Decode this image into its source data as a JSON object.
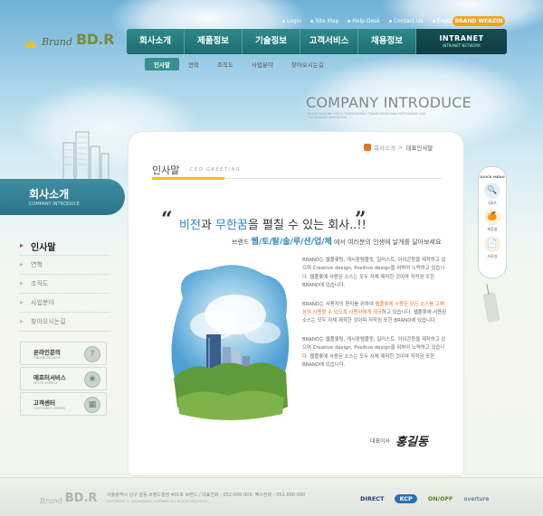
{
  "utility": [
    "Login",
    "Site Map",
    "Help Desk",
    "Contact Us",
    "English"
  ],
  "webzin": "BRAND WEBZIN",
  "logo": {
    "brand": "Brand",
    "mark": "BD.R"
  },
  "gnb": [
    "회사소개",
    "제품정보",
    "기술정보",
    "고객서비스",
    "채용정보"
  ],
  "intranet": {
    "title": "INTRANET",
    "subtitle": "INTRANET NETWORK"
  },
  "submenu": [
    "인사말",
    "연혁",
    "조직도",
    "사업분야",
    "찾아오시는길"
  ],
  "page_title": "COMPANY INTRODUCE",
  "page_subtitle": "BRAND WEBZINE OFFICE PROFESSIONAL TRANSFORMATIONAL PARTNERSHIP AND TECHNOLOGY INNOVATION",
  "section": {
    "title": "회사소개",
    "subtitle": "COMPANY INTRODUCE"
  },
  "left_menu": [
    "인사말",
    "연혁",
    "조직도",
    "사업분야",
    "찾아오시는길"
  ],
  "banners": [
    {
      "title": "온라인문의",
      "subtitle": "ONLINE REQUEST",
      "icon": "?"
    },
    {
      "title": "애프터서비스",
      "subtitle": "AFTER SERVICE",
      "icon": "❀"
    },
    {
      "title": "고객센터",
      "subtitle": "CUSTOMER CENTER",
      "icon": "▦"
    }
  ],
  "breadcrumb": {
    "home": "회사소개",
    "sep": ">",
    "current": "대표인사말"
  },
  "content_title": {
    "ko": "인사말",
    "en": "CEO GREETING"
  },
  "slogan": {
    "open_quote": "“",
    "close_quote": "”",
    "w1": "비전",
    "t1": "과 ",
    "w2": "무한꿈",
    "t2": "을 펼칠 수 있는 회사..!!",
    "l2a": "브랜드 ",
    "l2b": "웹/토/탈/솔/루/션/업/체",
    "l2c": " 에서 여러분의 인생에 날개를 달아보세요"
  },
  "body": {
    "p1": "BRAND는 웹플롯팅, 게시판템플릿, 일러스트, 아이콘등을 제작하고 있으며 Creative design, Positive design을 위하여 노력하고 있습니다. 웹플롯에 사용된 소스는 모두 자체 제작한 것이며 저작권 또한 BRAND에 있습니다.",
    "p2a": "BRAND는 사용자의 편리를 위하여 ",
    "p2b": "웹플롯에 사용된 모든 소스를 고해상의 사용할 수 있도록 사용자에게 제공",
    "p2c": "하고 있습니다. 웹플롯에 사용된 소스는 모두 자체 제작한 것이며 저작권 또한 BRAND에 있습니다.",
    "p3": "BRAND는 웹플롯팅, 게시판템플릿, 일러스트, 아이콘등을 제작하고 있으며 Creative design, Positive design을 위하여 노력하고 있습니다. 웹플롯에 사용된 소스는 모두 자체 제작한 것이며 저작권 또한 BRAND에 있습니다."
  },
  "sign": {
    "label": "대표이사",
    "name": "홍길동"
  },
  "quick": {
    "title": "QUICK MENU",
    "items": [
      {
        "label": "Q&A",
        "icon": "🔍"
      },
      {
        "label": "제품몰",
        "icon": "🍊"
      },
      {
        "label": "자료실",
        "icon": "📄"
      }
    ]
  },
  "footer": {
    "address": "서울광역시 남구 달동 브랜드빌딩 401호 브랜드 / 대표전화 : 052-000-000, 팩스전화 : 052-000-000",
    "copyright": "COPYRIGHT © 2006 BRAND COMPANY. ALL RIGHTS RESERVED.",
    "badges": [
      "DIRECT",
      "KCP",
      "ON/OFF",
      "overture"
    ]
  },
  "colors": {
    "gnb": "#2e8a8a",
    "accent": "#2b87ba",
    "highlight": "#e1762b",
    "title_bar": "#f0c21e"
  }
}
